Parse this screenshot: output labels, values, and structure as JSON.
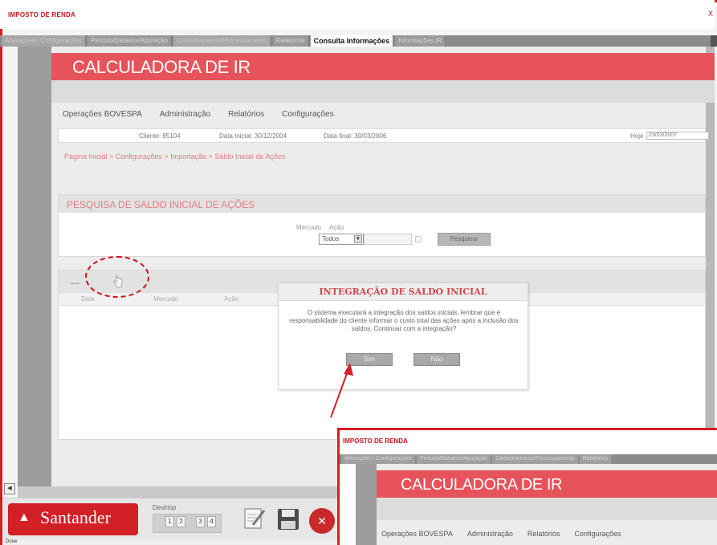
{
  "window": {
    "title": "IMPOSTO DE RENDA",
    "close_glyph": "X"
  },
  "tabs": [
    {
      "label": "Alterações / Configurações",
      "state": "inactive"
    },
    {
      "label": "Periodo/Dataexe/Apuração",
      "state": "inactive-dark"
    },
    {
      "label": "Cadastramento/Processamento",
      "state": "inactive"
    },
    {
      "label": "Relatórios",
      "state": "inactive-dark"
    },
    {
      "label": "Consulta Informações",
      "state": "active"
    },
    {
      "label": "Informações IR",
      "state": "inactive-dark"
    }
  ],
  "app": {
    "title": "CALCULADORA DE IR"
  },
  "menu": [
    "Operações BOVESPA",
    "Administração",
    "Relatórios",
    "Configurações"
  ],
  "infobar": {
    "cliente": "Cliente: 85104",
    "data_inicial": "Data Inicial: 30/12/2004",
    "data_final": "Data final: 30/03/2006",
    "hoje_label": "Hoje",
    "hoje_value": "23/03/2007"
  },
  "breadcrumb": "Página Inicial > Configurações > Importação > Saldo Inicial de Ações",
  "search_panel": {
    "title": "PESQUISA DE SALDO INICIAL DE AÇÕES",
    "mercado_label": "Mercado",
    "acao_label": "Ação",
    "mercado_value": "Todos",
    "search_button": "Pesquisar"
  },
  "grid": {
    "columns": [
      "Data",
      "Mercado",
      "Ação"
    ]
  },
  "dialog": {
    "title": "INTEGRAÇÃO DE SALDO INICIAL",
    "message": "O sistema executará a integração dos saldos iniciais, lembrar que é responsabilidade do cliente informar o custo total das ações após a inclusão dos saldos. Continuar com a integração?",
    "yes": "Sim",
    "no": "Não"
  },
  "taskbar": {
    "brand": "Santander",
    "desktop_label": "Desktop",
    "desktops": [
      "1",
      "2",
      "3",
      "4"
    ]
  },
  "status_bar": "Done",
  "inset": {
    "title": "IMPOSTO DE RENDA",
    "tabs": [
      "Alterações / Configurações",
      "Periodo/Dataexe/Apuração",
      "Cadastramento/Processamento",
      "Relatórios"
    ],
    "app_title": "CALCULADORA DE IR",
    "menu": [
      "Operações BOVESPA",
      "Administração",
      "Relatórios",
      "Configurações"
    ]
  },
  "colors": {
    "brand_red": "#d31f26",
    "header_red": "#e7535a",
    "link_pink": "#e07d80"
  }
}
